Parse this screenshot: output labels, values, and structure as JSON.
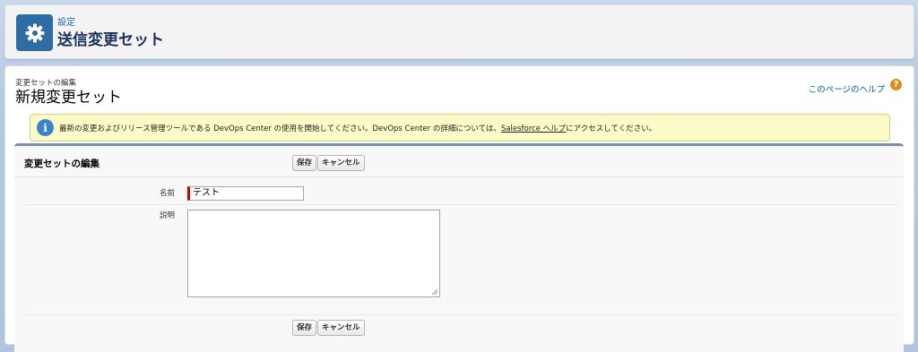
{
  "header": {
    "eyebrow": "設定",
    "title": "送信変更セット",
    "icon": "gear-icon",
    "icon_color": "#2e6da4"
  },
  "page": {
    "eyebrow": "変更セットの編集",
    "title": "新規変更セット",
    "help_link": "このページのヘルプ",
    "help_icon": "question-icon"
  },
  "info": {
    "icon": "info-icon",
    "text_before": "最新の変更およびリリース管理ツールである DevOps Center の使用を開始してください。DevOps Center の詳細については、",
    "link_text": "Salesforce ヘルプ",
    "text_after": "にアクセスしてください。"
  },
  "edit_block": {
    "title": "変更セットの編集",
    "save_label": "保存",
    "cancel_label": "キャンセル"
  },
  "form": {
    "name_label": "名前",
    "name_value": "テスト",
    "description_label": "説明",
    "description_value": ""
  },
  "colors": {
    "accent": "#2e6da4",
    "required": "#cc0000",
    "info_bg": "#fcfbc8"
  }
}
